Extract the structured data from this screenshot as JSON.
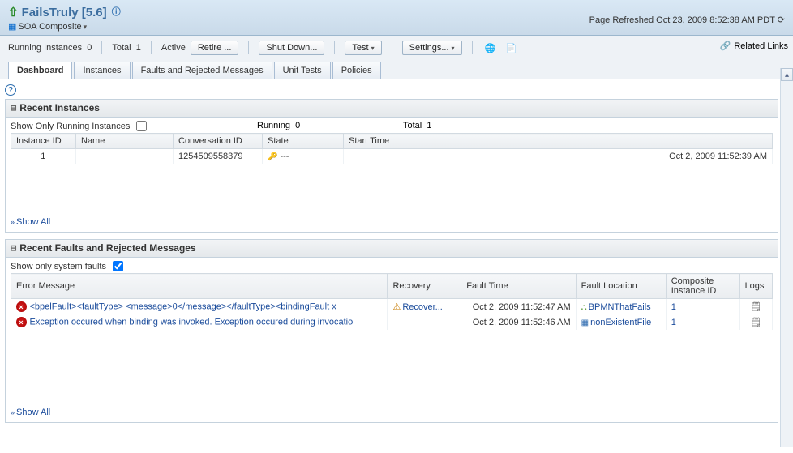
{
  "header": {
    "title": "FailsTruly [5.6]",
    "subtitle": "SOA Composite",
    "refreshed": "Page Refreshed Oct 23, 2009 8:52:38 AM PDT"
  },
  "toolbar": {
    "running_instances_label": "Running Instances",
    "running_instances_value": "0",
    "total_label": "Total",
    "total_value": "1",
    "active_label": "Active",
    "retire_btn": "Retire ...",
    "shutdown_btn": "Shut Down...",
    "test_btn": "Test",
    "settings_btn": "Settings...",
    "related_links": "Related Links"
  },
  "tabs": [
    "Dashboard",
    "Instances",
    "Faults and Rejected Messages",
    "Unit Tests",
    "Policies"
  ],
  "recent_instances": {
    "panel_title": "Recent Instances",
    "show_only_label": "Show Only Running Instances",
    "running_label": "Running",
    "running_value": "0",
    "total_label": "Total",
    "total_value": "1",
    "columns": [
      "Instance ID",
      "Name",
      "Conversation ID",
      "State",
      "Start Time"
    ],
    "rows": [
      {
        "id": "1",
        "name": "",
        "conv": "1254509558379",
        "state": "---",
        "start": "Oct 2, 2009 11:52:39 AM"
      }
    ],
    "show_all": "Show All"
  },
  "recent_faults": {
    "panel_title": "Recent Faults and Rejected Messages",
    "show_only_label": "Show only system faults",
    "columns": [
      "Error Message",
      "Recovery",
      "Fault Time",
      "Fault Location",
      "Composite Instance ID",
      "Logs"
    ],
    "rows": [
      {
        "msg": "<bpelFault><faultType> <message>0</message></faultType><bindingFault x",
        "recovery": "Recover...",
        "time": "Oct 2, 2009 11:52:47 AM",
        "loc": "BPMNThatFails",
        "cid": "1"
      },
      {
        "msg": "Exception occured when binding was invoked. Exception occured during invocatio",
        "recovery": "",
        "time": "Oct 2, 2009 11:52:46 AM",
        "loc": "nonExistentFile",
        "cid": "1"
      }
    ],
    "show_all": "Show All"
  }
}
